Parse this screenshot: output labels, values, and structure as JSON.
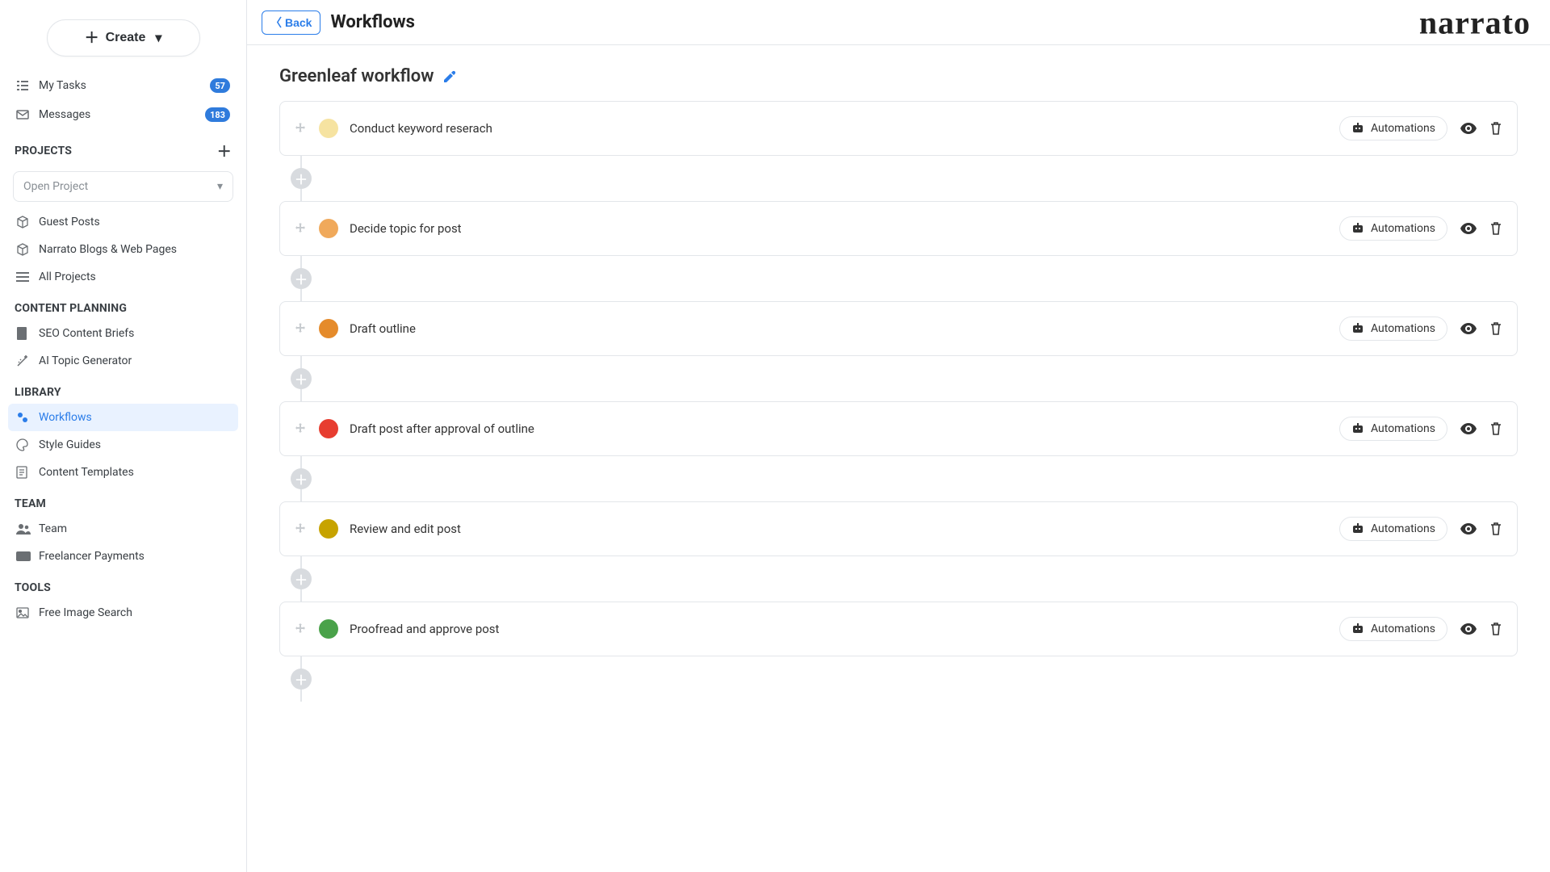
{
  "brand": "narrato",
  "topbar": {
    "back": "Back",
    "title": "Workflows"
  },
  "sidebar": {
    "create": "Create",
    "my_tasks": {
      "label": "My Tasks",
      "count": "57"
    },
    "messages": {
      "label": "Messages",
      "count": "183"
    },
    "sections": {
      "projects": "PROJECTS",
      "content_planning": "CONTENT PLANNING",
      "library": "LIBRARY",
      "team": "TEAM",
      "tools": "TOOLS"
    },
    "open_project_placeholder": "Open Project",
    "projects": [
      {
        "label": "Guest Posts"
      },
      {
        "label": "Narrato Blogs & Web Pages"
      },
      {
        "label": "All Projects"
      }
    ],
    "planning": [
      {
        "label": "SEO Content Briefs"
      },
      {
        "label": "AI Topic Generator"
      }
    ],
    "library": [
      {
        "label": "Workflows",
        "active": true
      },
      {
        "label": "Style Guides"
      },
      {
        "label": "Content Templates"
      }
    ],
    "team": [
      {
        "label": "Team"
      },
      {
        "label": "Freelancer Payments"
      }
    ],
    "tools": [
      {
        "label": "Free Image Search"
      }
    ]
  },
  "workflow": {
    "title": "Greenleaf workflow",
    "automations_label": "Automations",
    "steps": [
      {
        "name": "Conduct keyword reserach",
        "color": "#f6e3a1"
      },
      {
        "name": "Decide topic for post",
        "color": "#f0a95b"
      },
      {
        "name": "Draft outline",
        "color": "#e58b2b"
      },
      {
        "name": "Draft post after approval of outline",
        "color": "#e73d30"
      },
      {
        "name": "Review and edit post",
        "color": "#c7a300"
      },
      {
        "name": "Proofread and approve post",
        "color": "#4aa24a"
      }
    ]
  }
}
